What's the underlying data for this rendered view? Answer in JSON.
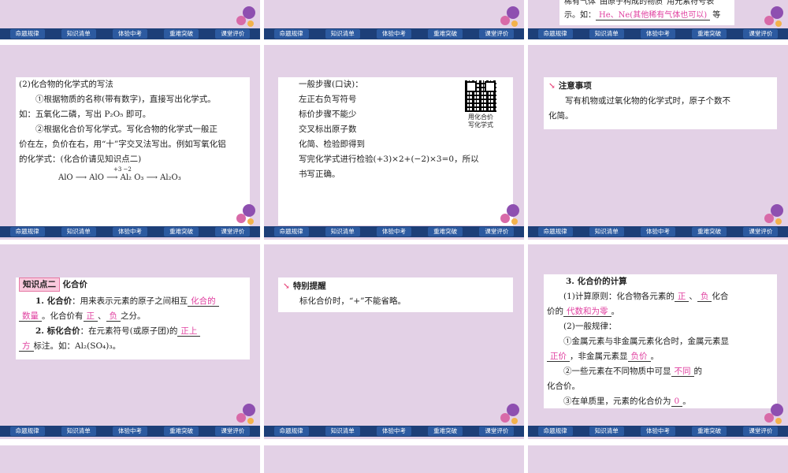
{
  "nav": [
    "命题规律",
    "知识清单",
    "体验中考",
    "重难突破",
    "课堂评价"
  ],
  "slides": {
    "s3_top": {
      "line1": "稀有气体”由原子构成的物质”用元素符号表",
      "line2_pre": "示。如：",
      "blank": "He、Ne(其他稀有气体也可以)",
      "line2_post": "等"
    },
    "s4": {
      "l1": "(2)化合物的化学式的写法",
      "l2": "①根据物质的名称(带有数字)，直接写出化学式。",
      "l3": "如：五氧化二磷，写出 P₂O₅ 即可。",
      "l4": "②根据化合价写化学式。写化合物的化学式一般正",
      "l5": "价在左，负价在右，用“十”字交叉法写出。例如写氧化铝",
      "l6": "的化学式：(化合价请见知识点二)",
      "eq": "AlO ⟶ AlO ⟶ Al₂ O₃ ⟶ Al₂O₃",
      "val1": "+3 −2",
      "val2": "+3   −2"
    },
    "s5": {
      "l1": "一般步骤(口诀)：",
      "l2": "左正右负写符号",
      "l3": "标价步骤不能少",
      "l4": "交叉标出原子数",
      "l5": "化简、检验即得到",
      "l6": "写完化学式进行检验(+3)×2+(−2)×3=0，所以",
      "l7": "书写正确。",
      "qr_caption1": "用化合价",
      "qr_caption2": "写化学式"
    },
    "s6": {
      "title": "注意事项",
      "text1": "写有机物或过氧化物的化学式时，原子个数不",
      "text2": "化简。"
    },
    "s7": {
      "tag": "知识点二",
      "title": "化合价",
      "p1_a": "1. 化合价",
      "p1_b": "：用来表示元素的原子之间相互",
      "blank1": "化合的",
      "blank1b": "数量",
      "p1_c": "。化合价有",
      "blank2": "正",
      "blank3": "负",
      "p1_d": "之分。",
      "p2_a": "2. 标化合价",
      "p2_b": "：在元素符号(或原子团)的",
      "blank4": "正上",
      "blank4b": "方",
      "p2_c": "标注。如：Al₂(SO₄)₃。",
      "sup": "+3  −2"
    },
    "s8": {
      "title": "特别提醒",
      "text": "标化合价时，“+”不能省略。"
    },
    "s9": {
      "h": "3. 化合价的计算",
      "l1_a": "(1)计算原则：化合物各元素的",
      "b1": "正",
      "b2": "负",
      "l1_b": "化合",
      "l2_a": "价的",
      "b3": "代数和为零",
      "l3": "(2)一般规律：",
      "l4": "①金属元素与非金属元素化合时，金属元素显",
      "b4": "正价",
      "l5_a": "，非金属元素显",
      "b5": "负价",
      "l6": "②一些元素在不同物质中可显",
      "b6": "不同",
      "l6_b": "的",
      "l7": "化合价。",
      "l8": "③在单质里，元素的化合价为",
      "b7": "0"
    }
  }
}
